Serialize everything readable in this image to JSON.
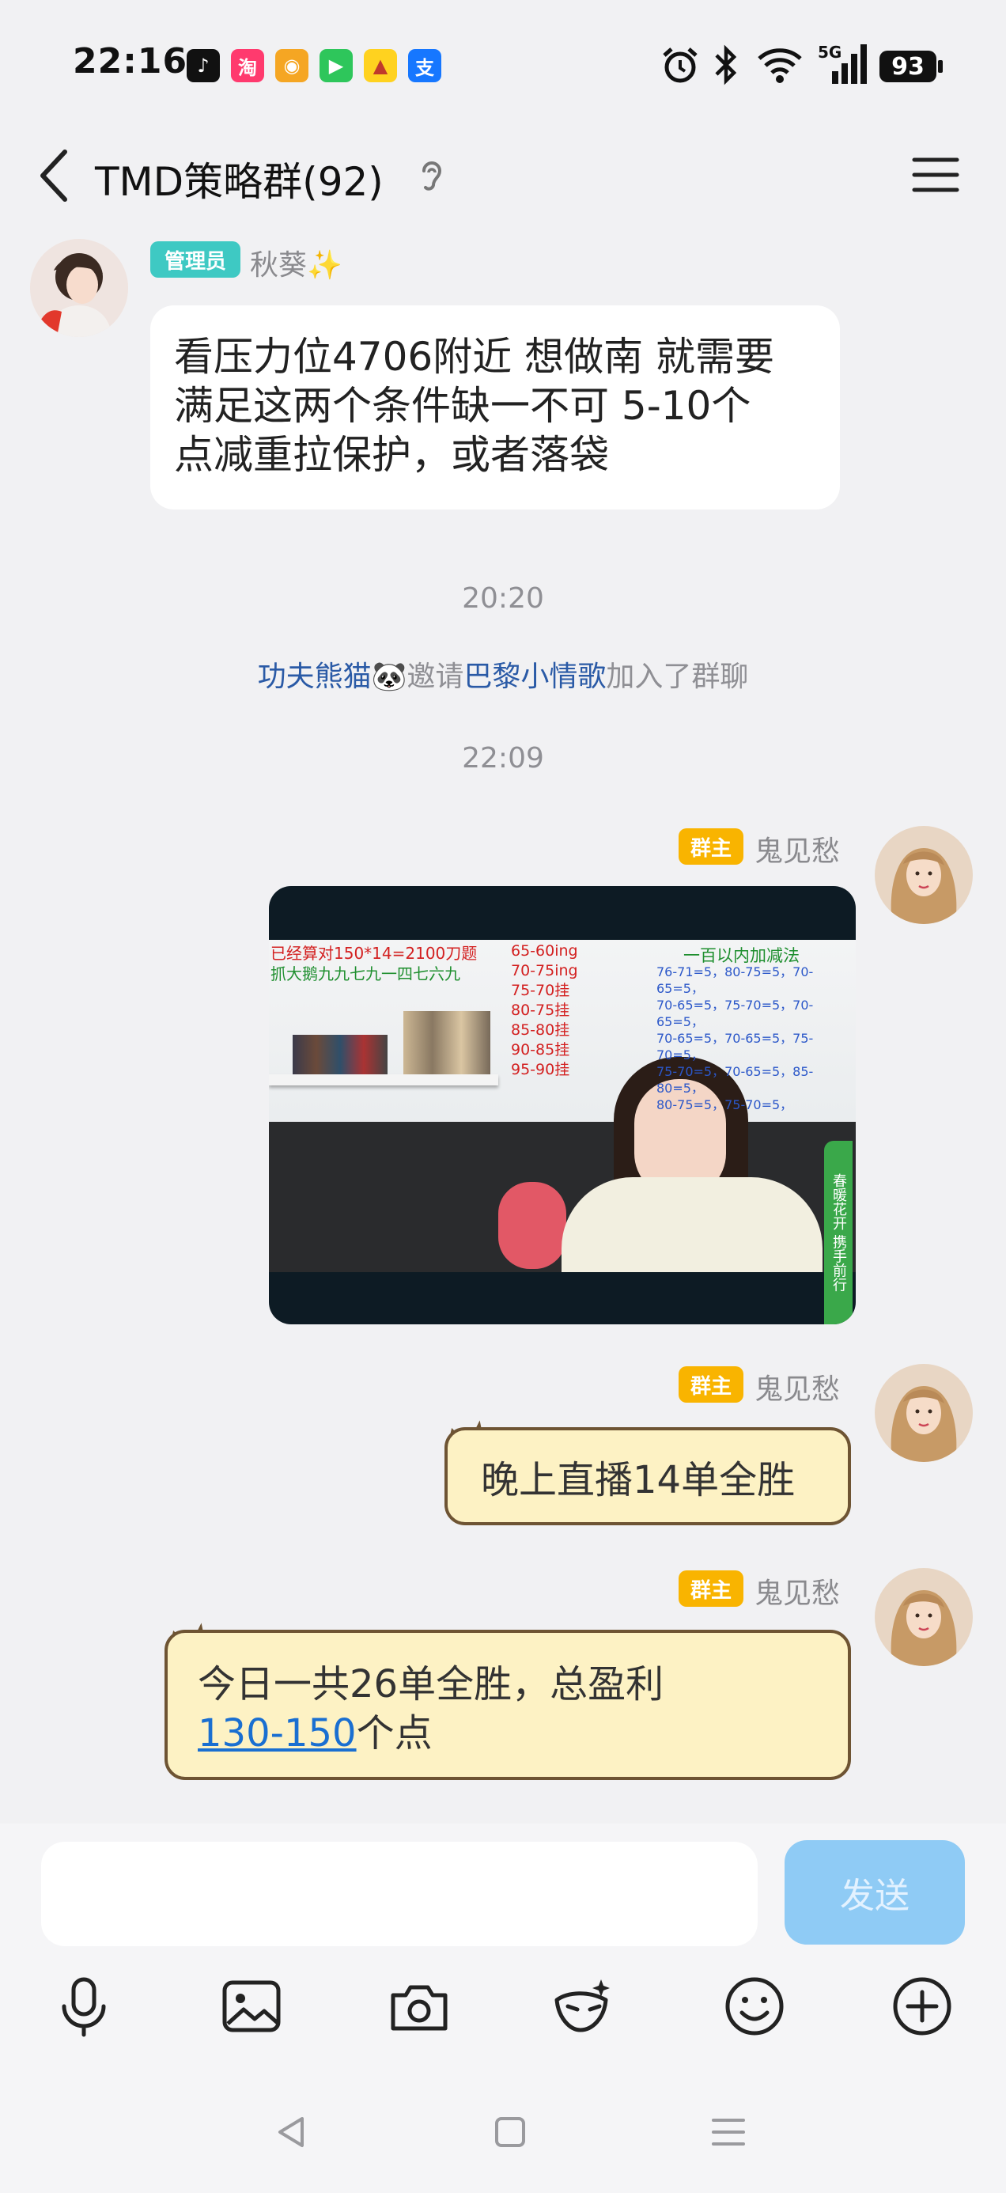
{
  "status_bar": {
    "time": "22:16",
    "apps": [
      {
        "name": "tiktok-icon",
        "glyph": "♪",
        "color": "#111111"
      },
      {
        "name": "taobao-icon",
        "glyph": "淘",
        "color": "#ff3a6e"
      },
      {
        "name": "weibo-icon",
        "glyph": "◉",
        "color": "#f5a623"
      },
      {
        "name": "iqiyi-icon",
        "glyph": "▶",
        "color": "#2ec65b"
      },
      {
        "name": "meituan-icon",
        "glyph": "▲",
        "color": "#ffd21f"
      },
      {
        "name": "alipay-icon",
        "glyph": "支",
        "color": "#1677ff"
      }
    ],
    "network": "5G",
    "battery": "93"
  },
  "header": {
    "title": "TMD策略群(92)"
  },
  "messages": [
    {
      "role_badge": "管理员",
      "sender": "秋葵✨",
      "text_lines": [
        "看压力位4706附近 想做南 就需要",
        "满足这两个条件缺一不可 5-10个",
        "点减重拉保护，或者落袋"
      ]
    }
  ],
  "separators": [
    "20:20",
    "22:09"
  ],
  "system_message": {
    "inviter": "功夫熊猫🐼",
    "action": "邀请",
    "invitee": "巴黎小情歌",
    "suffix": "加入了群聊"
  },
  "owner_messages": {
    "role_badge": "群主",
    "sender": "鬼见愁",
    "image": {
      "overlay_left_1": "已经算对150*14=2100刀题",
      "overlay_left_2": "抓大鹅九九七九一四七六九",
      "overlay_mid": [
        "65-60ing",
        "70-75ing",
        "75-70挂",
        "80-75挂",
        "85-80挂",
        "90-85挂",
        "95-90挂"
      ],
      "overlay_right_title": "一百以内加减法",
      "overlay_right": [
        "76-71=5，80-75=5，70-65=5，",
        "70-65=5，75-70=5，70-65=5，",
        "70-65=5，70-65=5，75-70=5，",
        "75-70=5，70-65=5，85-80=5，",
        "80-75=5，75-70=5，"
      ],
      "side_banner": "春暖花开 携手前行"
    },
    "bubble_1": "晚上直播14单全胜",
    "bubble_2_line1": "今日一共26单全胜，总盈利",
    "bubble_2_link": "130-150",
    "bubble_2_suffix": "个点"
  },
  "composer": {
    "placeholder": "",
    "send_label": "发送"
  },
  "toolbar_icons": [
    "microphone-icon",
    "image-icon",
    "camera-icon",
    "redpacket-mask-icon",
    "emoji-icon",
    "plus-icon"
  ],
  "colors": {
    "accent_blue": "#2a5aa6",
    "admin_badge": "#3ec9c3",
    "owner_badge": "#f9b400",
    "send_button": "#8fcbf5"
  }
}
